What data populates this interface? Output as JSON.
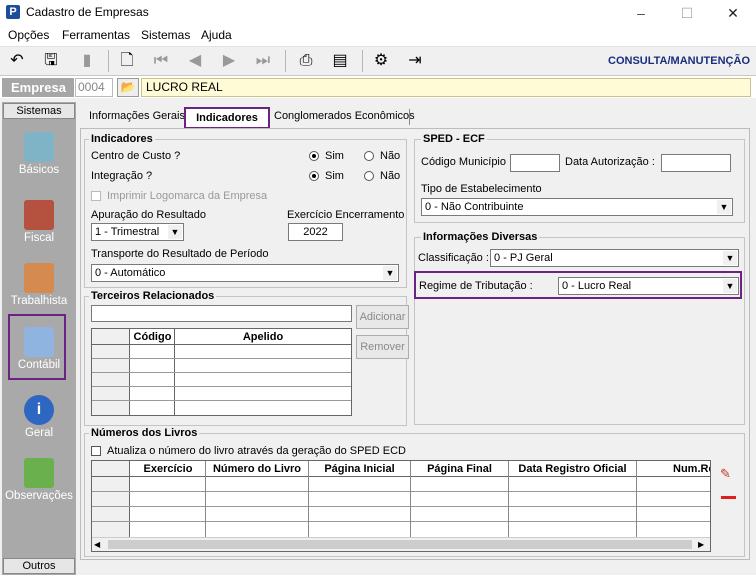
{
  "window": {
    "title": "Cadastro de Empresas",
    "app_icon": "P",
    "minimize": "–",
    "maximize": "☐",
    "close": "✕"
  },
  "menu": [
    "Opções",
    "Ferramentas",
    "Sistemas",
    "Ajuda"
  ],
  "toolbar": {
    "mode_label": "CONSULTA/MANUTENÇÃO",
    "icons": [
      "undo-icon",
      "save-icon",
      "bookmark-icon",
      "preview-icon",
      "first-icon",
      "prev-icon",
      "next-icon",
      "last-icon",
      "print-icon",
      "report-icon",
      "settings-icon",
      "exit-icon"
    ]
  },
  "empresa": {
    "label": "Empresa",
    "code": "0004",
    "name": "LUCRO REAL"
  },
  "sidebar": {
    "header": "Sistemas",
    "footer": "Outros",
    "items": [
      "Básicos",
      "Fiscal",
      "Trabalhista",
      "Contábil",
      "Geral",
      "Observações"
    ]
  },
  "tabs": [
    "Informações Gerais",
    "Indicadores",
    "Conglomerados Econômicos"
  ],
  "indicadores": {
    "title": "Indicadores",
    "centro_custo": {
      "label": "Centro de Custo ?",
      "sim": "Sim",
      "nao": "Não",
      "value": "Sim"
    },
    "integracao": {
      "label": "Integração ?",
      "sim": "Sim",
      "nao": "Não",
      "value": "Sim"
    },
    "imprimir_logo": "Imprimir Logomarca da Empresa",
    "apuracao_label": "Apuração do Resultado",
    "apuracao_value": "1 - Trimestral",
    "exercicio_label": "Exercício Encerramento",
    "exercicio_value": "2022",
    "transporte_label": "Transporte do Resultado de Período",
    "transporte_value": "0 - Automático"
  },
  "sped": {
    "title": "SPED - ECF",
    "codigo_municipio": "Código Município :",
    "data_autorizacao": "Data Autorização :",
    "tipo_estab_label": "Tipo de Estabelecimento",
    "tipo_estab_value": "0 - Não Contribuinte"
  },
  "diversas": {
    "title": "Informações Diversas",
    "classificacao_label": "Classificação :",
    "classificacao_value": "0 - PJ Geral",
    "regime_label": "Regime de Tributação :",
    "regime_value": "0 - Lucro Real"
  },
  "terceiros": {
    "title": "Terceiros Relacionados",
    "col_codigo": "Código",
    "col_apelido": "Apelido",
    "adicionar": "Adicionar",
    "remover": "Remover"
  },
  "livros": {
    "title": "Números dos Livros",
    "checkbox": "Atualiza o número do livro através da geração do SPED ECD",
    "columns": [
      "Exercício",
      "Número do Livro",
      "Página Inicial",
      "Página Final",
      "Data Registro Oficial",
      "Num.Re"
    ]
  },
  "colors": {
    "accent": "#6a2283",
    "mode": "#1a2e7e",
    "empresa_bg": "#fffbd7"
  }
}
